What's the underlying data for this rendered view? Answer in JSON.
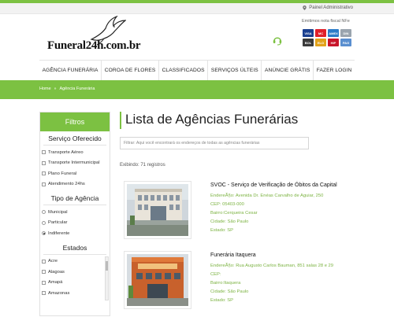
{
  "topbar": {
    "painel_label": "Painel Administrativo"
  },
  "header": {
    "logo_text": "Funeral24h.com.br",
    "emitimos_label": "Emitimos nota fiscal NFe",
    "cards": [
      {
        "name": "VISA",
        "color": "#1a3f8f"
      },
      {
        "name": "MC",
        "color": "#e0202a"
      },
      {
        "name": "AMEX",
        "color": "#2b7cc8"
      },
      {
        "name": "DIN",
        "color": "#9aa4ae"
      },
      {
        "name": "BOL",
        "color": "#3a3a3a"
      },
      {
        "name": "ELO",
        "color": "#e2a21b"
      },
      {
        "name": "HIP",
        "color": "#c8152a"
      },
      {
        "name": "PAG",
        "color": "#5a8fd0"
      }
    ]
  },
  "nav": {
    "items": [
      "AGÊNCIA FUNERÁRIA",
      "COROA DE FLORES",
      "CLASSIFICADOS",
      "SERVIÇOS ÚLTEIS",
      "ANÚNCIE GRÁTIS",
      "FAZER LOGIN"
    ]
  },
  "breadcrumb": {
    "home": "Home",
    "sep": "»",
    "current": "Agência Funerária"
  },
  "sidebar": {
    "title": "Filtros",
    "servico_title": "Serviço Oferecido",
    "servico_options": [
      "Transporte Aéreo",
      "Transporte Intermunicipal",
      "Plano Funeral",
      "Atendimento 24hs"
    ],
    "tipo_title": "Tipo de Agência",
    "tipo_options": [
      "Municipal",
      "Particular",
      "Indiferente"
    ],
    "tipo_selected": "Indiferente",
    "estados_title": "Estados",
    "estados_options": [
      "Acre",
      "Alagoas",
      "Amapá",
      "Amazonas"
    ]
  },
  "main": {
    "title": "Lista de Agências Funerárias",
    "filter_placeholder": "Filtrar: Aqui você encontrará os endereços de todas as agências funerárias",
    "exibindo": "Exibindo: 71 registros",
    "results": [
      {
        "title": "SVOC - Serviço de Verificação de Óbitos da Capital",
        "endereco": "EndereÃ§o: Avenida Dr. Enéas Carvalho de Aguiar, 250",
        "cep": "CEP: 05403-000",
        "bairro": "Bairro:Cerqueira Cesar",
        "cidade": "Cidade: São Paulo",
        "estado": "Estado: SP"
      },
      {
        "title": "Funerária Itaquera",
        "endereco": "EndereÃ§o: Rua Augusto Carlos Bauman, 851 salas 28 e 29",
        "cep": "CEP:",
        "bairro": "Bairro:Itaquera",
        "cidade": "Cidade: São Paulo",
        "estado": "Estado: SP"
      }
    ]
  }
}
